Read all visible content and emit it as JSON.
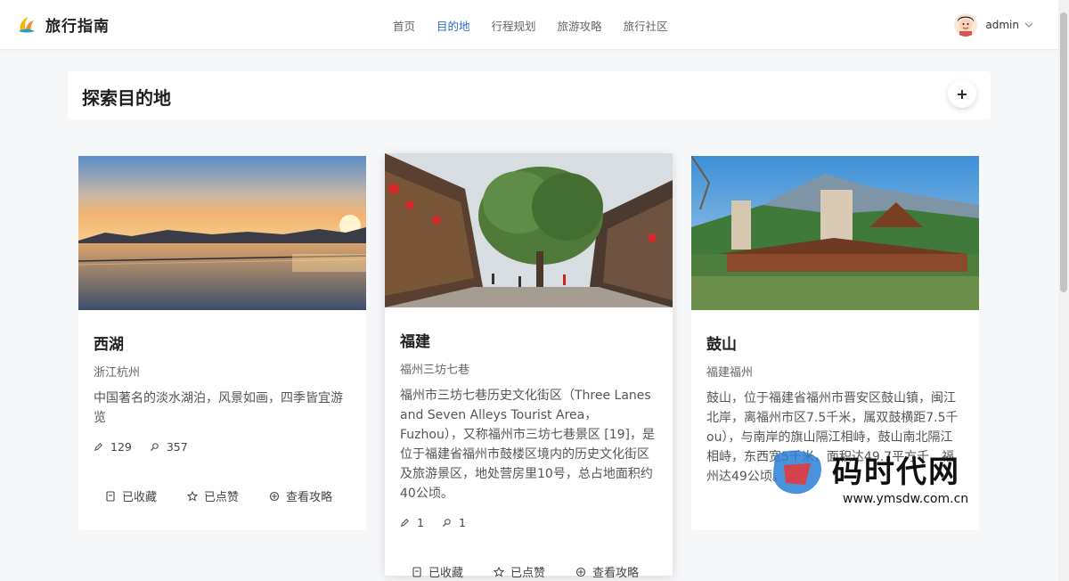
{
  "app": {
    "name": "旅行指南"
  },
  "nav": {
    "items": [
      "首页",
      "目的地",
      "行程规划",
      "旅游攻略",
      "旅行社区"
    ],
    "active_index": 1
  },
  "user": {
    "name": "admin"
  },
  "page": {
    "title": "探索目的地",
    "add_label": "+"
  },
  "actions": {
    "favorited": "已收藏",
    "liked": "已点赞",
    "view_guide": "查看攻略"
  },
  "cards": [
    {
      "title": "西湖",
      "location": "浙江杭州",
      "description": "中国著名的淡水湖泊，风景如画，四季皆宜游览",
      "likes": "129",
      "views": "357"
    },
    {
      "title": "福建",
      "location": "福州三坊七巷",
      "description": "福州市三坊七巷历史文化街区（Three Lanes and Seven Alleys Tourist Area，Fuzhou），又称福州市三坊七巷景区 [19]，是位于福建省福州市鼓楼区境内的历史文化街区及旅游景区，地处营房里10号，总占地面积约40公顷。",
      "likes": "1",
      "views": "1"
    },
    {
      "title": "鼓山",
      "location": "福建福州",
      "description": "鼓山，位于福建省福州市晋安区鼓山镇，闽江北岸，离福州市区7.5千米，属双鼓横距7.5千ou），与南岸的旗山隔江相峙，鼓山南北隔江相峙，东西宽5千米，面积达49.7平方千，福州达49公顷。"
    }
  ],
  "watermark": {
    "text": "码时代网",
    "url": "www.ymsdw.com.cn"
  },
  "colors": {
    "accent": "#2f6bdb"
  }
}
